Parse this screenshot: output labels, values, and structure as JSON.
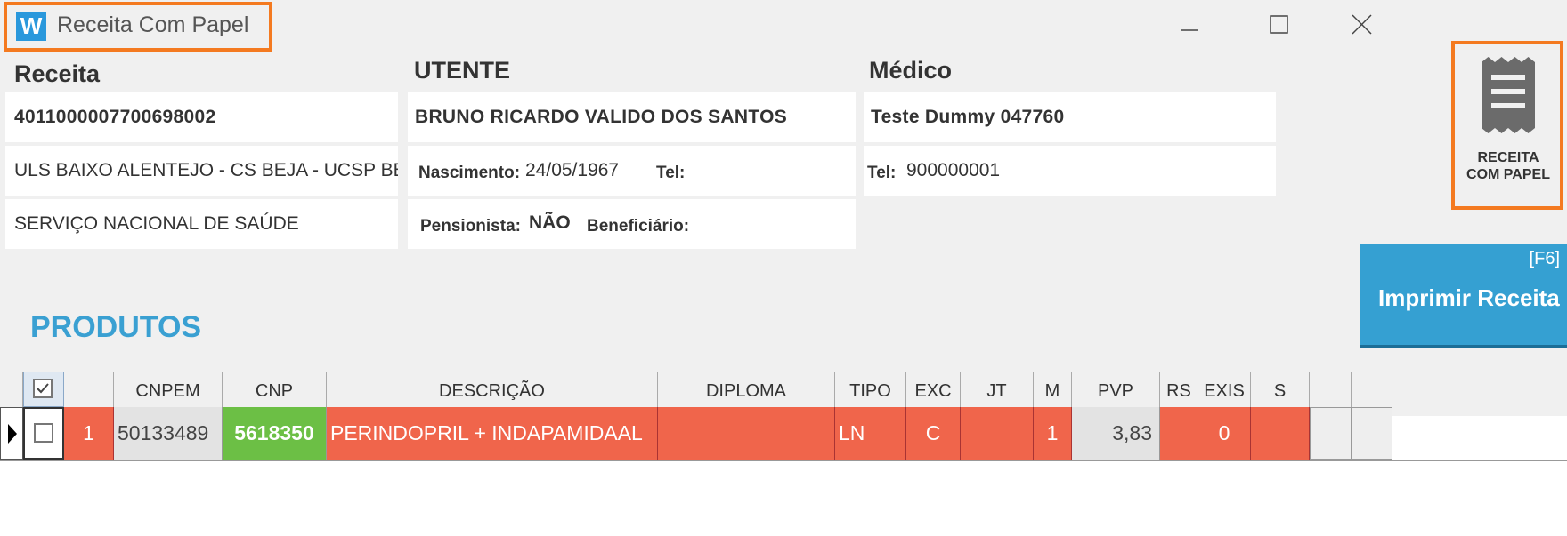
{
  "window": {
    "title": "Receita Com Papel",
    "logo_letter": "W"
  },
  "receita": {
    "label": "Receita",
    "number": "4011000007700698002",
    "location": "ULS BAIXO ALENTEJO - CS BEJA - UCSP BE",
    "entity": "SERVIÇO NACIONAL DE SAÚDE"
  },
  "utente": {
    "label": "UTENTE",
    "name": "BRUNO RICARDO VALIDO DOS SANTOS",
    "nascimento_label": "Nascimento:",
    "nascimento": "24/05/1967",
    "tel_label": "Tel:",
    "tel": "",
    "pensionista_label": "Pensionista:",
    "pensionista": "NÃO",
    "beneficiario_label": "Beneficiário:",
    "beneficiario": ""
  },
  "medico": {
    "label": "Médico",
    "name": "Teste Dummy 047760",
    "tel_label": "Tel:",
    "tel": "900000001"
  },
  "side_button": {
    "line1": "RECEITA",
    "line2": "COM PAPEL"
  },
  "print_button": {
    "shortcut": "[F6]",
    "label": "Imprimir Receita"
  },
  "section_title": "PRODUTOS",
  "table": {
    "headers": [
      "CNPEM",
      "CNP",
      "DESCRIÇÃO",
      "DIPLOMA",
      "TIPO",
      "EXC",
      "JT",
      "M",
      "PVP",
      "RS",
      "EXIS",
      "S"
    ],
    "rows": [
      {
        "index": "1",
        "cnpem": "50133489",
        "cnp": "5618350",
        "descricao": "PERINDOPRIL + INDAPAMIDAAL",
        "diploma": "",
        "tipo": "LN",
        "exc": "C",
        "jt": "",
        "m": "1",
        "pvp": "3,83",
        "rs": "",
        "exis": "0",
        "s": ""
      }
    ]
  },
  "colors": {
    "accent_orange": "#f47a20",
    "primary_blue": "#35a0d2",
    "row_red": "#f0654b",
    "cnp_green": "#6cbf45"
  }
}
